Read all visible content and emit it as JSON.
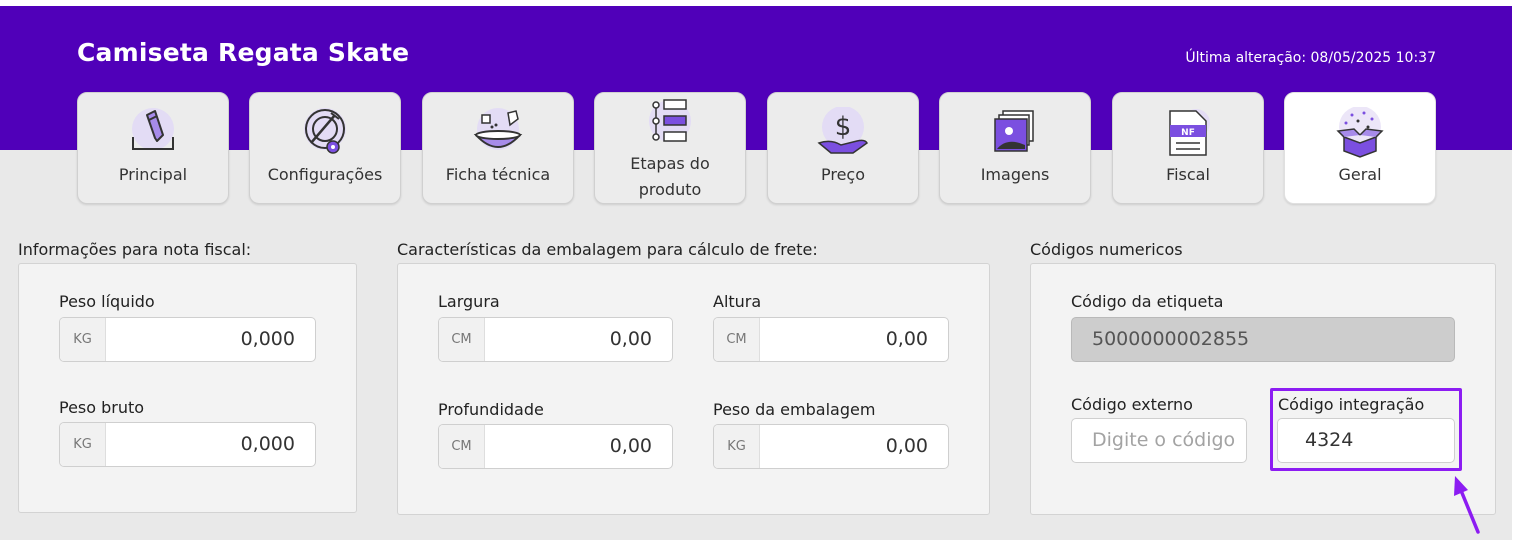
{
  "header": {
    "title": "Camiseta Regata Skate",
    "last_modified": "Última alteração: 08/05/2025 10:37"
  },
  "tabs": [
    {
      "label": "Principal",
      "icon": "pencil-edit-icon"
    },
    {
      "label": "Configurações",
      "icon": "plate-gear-icon"
    },
    {
      "label": "Ficha técnica",
      "icon": "recipe-bowl-icon"
    },
    {
      "label_line1": "Etapas do",
      "label_line2": "produto",
      "icon": "steps-list-icon"
    },
    {
      "label": "Preço",
      "icon": "dollar-hand-icon"
    },
    {
      "label": "Imagens",
      "icon": "images-icon"
    },
    {
      "label": "Fiscal",
      "icon": "nf-document-icon"
    },
    {
      "label": "Geral",
      "icon": "open-box-icon",
      "active": true
    }
  ],
  "nota_fiscal": {
    "title": "Informações para nota fiscal:",
    "peso_liquido": {
      "label": "Peso líquido",
      "unit": "KG",
      "value": "0,000"
    },
    "peso_bruto": {
      "label": "Peso bruto",
      "unit": "KG",
      "value": "0,000"
    }
  },
  "embalagem": {
    "title": "Características da embalagem para cálculo de frete:",
    "largura": {
      "label": "Largura",
      "unit": "CM",
      "value": "0,00"
    },
    "altura": {
      "label": "Altura",
      "unit": "CM",
      "value": "0,00"
    },
    "profundidade": {
      "label": "Profundidade",
      "unit": "CM",
      "value": "0,00"
    },
    "peso_embalagem": {
      "label": "Peso da embalagem",
      "unit": "KG",
      "value": "0,00"
    }
  },
  "codigos": {
    "title": "Códigos numericos",
    "etiqueta": {
      "label": "Código da etiqueta",
      "value": "5000000002855"
    },
    "externo": {
      "label": "Código externo",
      "placeholder": "Digite o código"
    },
    "integracao": {
      "label": "Código integração",
      "value": "4324"
    }
  },
  "colors": {
    "brand": "#5000b9",
    "highlight": "#8c1cf2",
    "icon_accent": "#7b4fe0"
  }
}
